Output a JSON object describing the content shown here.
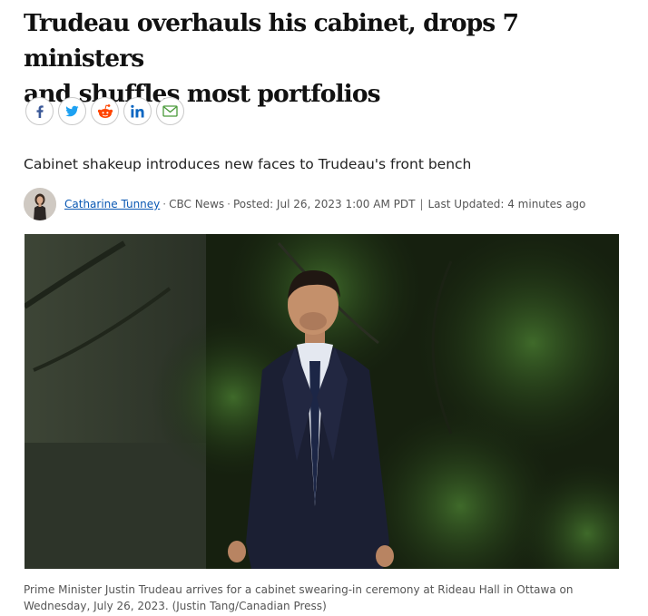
{
  "article": {
    "headline_line1": "Trudeau overhauls his cabinet, drops 7 ministers",
    "headline_line2": "and shuffles most portfolios",
    "deck": "Cabinet shakeup introduces new faces to Trudeau's front bench",
    "byline": {
      "author": "Catharine Tunney",
      "source": "CBC News",
      "posted": "Posted: Jul 26, 2023 1:00 AM PDT",
      "divider": "|",
      "updated": "Last Updated: 4 minutes ago"
    },
    "caption_line1": "Prime Minister Justin Trudeau arrives for a cabinet swearing-in ceremony at Rideau Hall in Ottawa on",
    "caption_line2": "Wednesday, July 26, 2023. (Justin Tang/Canadian Press)"
  },
  "share": {
    "icons": [
      "facebook-icon",
      "twitter-icon",
      "reddit-icon",
      "linkedin-icon",
      "email-icon"
    ],
    "colors": {
      "facebook": "#3b5998",
      "twitter": "#1da1f2",
      "reddit": "#ff4500",
      "linkedin": "#0a66c2",
      "email": "#4a9a3a"
    }
  },
  "colors": {
    "link": "#0a58b3",
    "meta_text": "#555555",
    "headline": "#111111"
  }
}
